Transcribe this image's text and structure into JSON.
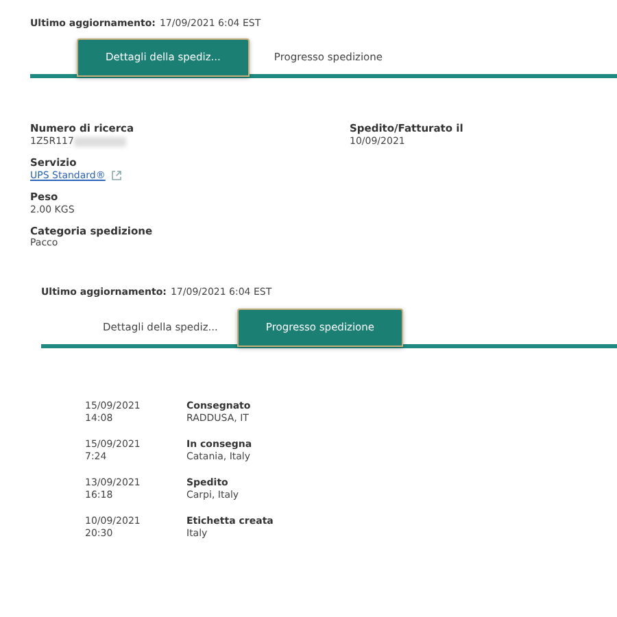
{
  "details_view": {
    "last_update": {
      "label": "Ultimo aggiornamento:",
      "value": "17/09/2021 6:04 EST"
    },
    "tabs": [
      {
        "label": "Dettagli della spediz...",
        "selected": true
      },
      {
        "label": "Progresso spedizione",
        "selected": false
      }
    ],
    "fields_left": [
      {
        "label": "Numero di ricerca",
        "value": "1Z5R117",
        "redacted": true,
        "kind": "text"
      },
      {
        "label": "Servizio",
        "value": "UPS Standard®",
        "kind": "link"
      },
      {
        "label": "Peso",
        "value": "2.00 KGS",
        "kind": "text"
      },
      {
        "label": "Categoria spedizione",
        "value": "Pacco",
        "kind": "text"
      }
    ],
    "fields_right": [
      {
        "label": "Spedito/Fatturato il",
        "value": "10/09/2021"
      }
    ]
  },
  "progress_view": {
    "last_update": {
      "label": "Ultimo aggiornamento:",
      "value": "17/09/2021 6:04 EST"
    },
    "tabs": [
      {
        "label": "Dettagli della spediz...",
        "selected": false
      },
      {
        "label": "Progresso spedizione",
        "selected": true
      }
    ],
    "events": [
      {
        "date": "15/09/2021",
        "time": "14:08",
        "status": "Consegnato",
        "location": "RADDUSA, IT"
      },
      {
        "date": "15/09/2021",
        "time": "7:24",
        "status": "In consegna",
        "location": "Catania, Italy"
      },
      {
        "date": "13/09/2021",
        "time": "16:18",
        "status": "Spedito",
        "location": "Carpi, Italy"
      },
      {
        "date": "10/09/2021",
        "time": "20:30",
        "status": "Etichetta creata",
        "location": "Italy"
      }
    ]
  }
}
